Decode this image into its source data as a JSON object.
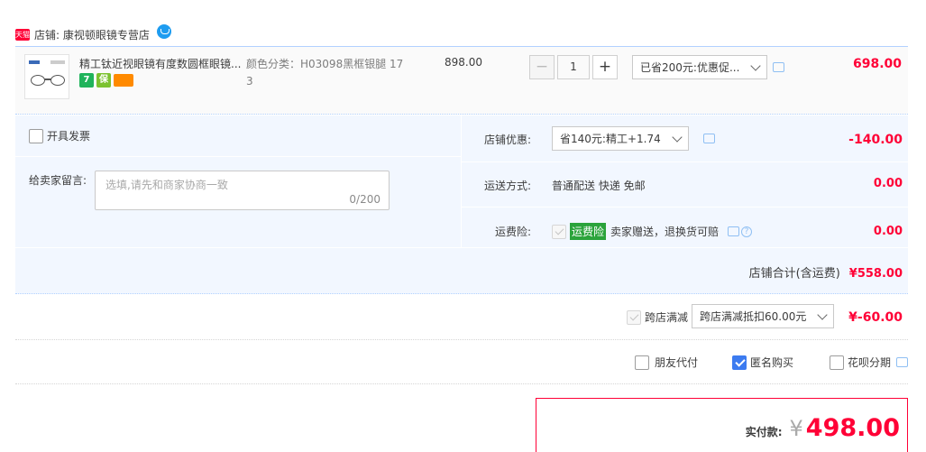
{
  "shop": {
    "badge": "天猫",
    "label": "店铺: 康视顿眼镜专营店"
  },
  "item": {
    "title": "精工钛近视眼镜有度数圆框眼镜...",
    "sku": "颜色分类：H03098黑框银腿 17 3",
    "unit_price": "898.00",
    "quantity": "1",
    "promo_select": "已省200元:优惠促...",
    "item_total": "698.00",
    "service_icons": [
      "7",
      "保",
      "card-icon"
    ]
  },
  "invoice": {
    "label": "开具发票"
  },
  "message": {
    "label": "给卖家留言:",
    "placeholder": "选填,请先和商家协商一致",
    "counter": "0/200"
  },
  "shop_discount": {
    "label": "店铺优惠:",
    "select": "省140元:精工+1.74",
    "amount": "-140.00"
  },
  "shipping": {
    "label": "运送方式:",
    "value": "普通配送 快递 免邮",
    "amount": "0.00"
  },
  "insurance": {
    "label": "运费险:",
    "badge": "运费险",
    "text": "卖家赠送，退换货可赔",
    "amount": "0.00"
  },
  "shop_total": {
    "label": "店铺合计(含运费)",
    "amount": "¥558.00"
  },
  "cross_store": {
    "label": "跨店满减",
    "select": "跨店满减抵扣60.00元",
    "amount": "¥-60.00"
  },
  "options": {
    "friend_pay": "朋友代付",
    "anonymous": "匿名购买",
    "huabei": "花呗分期"
  },
  "payment": {
    "label": "实付款:",
    "currency": "¥",
    "amount": "498.00"
  },
  "colors": {
    "accent_red": "#ff0036",
    "panel_blue": "#f2f7ff",
    "check_blue": "#3c7bf0",
    "insurance_green": "#2ba33b"
  }
}
